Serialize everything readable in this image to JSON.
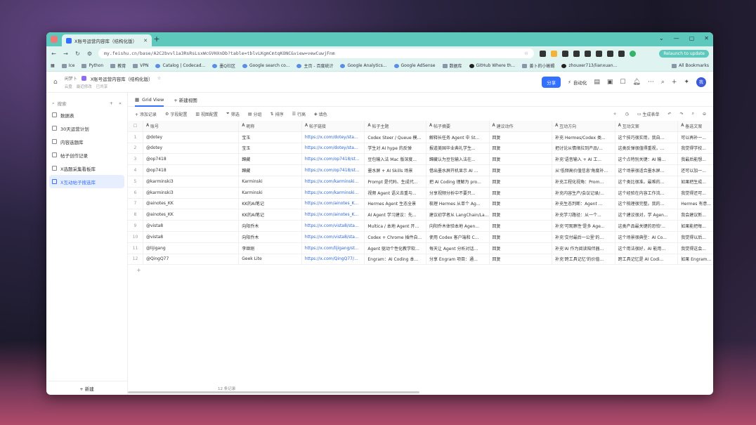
{
  "browser": {
    "tab_title": "X账号运营内容库（结构化版）",
    "url": "my.feishu.cn/base/A2C2bvvl1a3RsRsLsxWcGVHXnDb?table=tblvLKgmCmtqKONC&view=vewCuwjFnm",
    "update_label": "Relaunch to update",
    "bookmarks": [
      "Ice",
      "Python",
      "教育",
      "VPN",
      "Catalog | Codecad...",
      "墨Q社区",
      "Google search co...",
      "主页 - 百度统计",
      "Google Analytics...",
      "Google AdSense",
      "数据库",
      "GitHub Where th...",
      "姜卜的小蜥蜴",
      "zhouxer713/lianxuan..."
    ],
    "all_bookmarks": "All Bookmarks"
  },
  "app": {
    "crumb_root": "闲梦卜",
    "title": "X账号运营内容库（结构化版）",
    "crumb_sub": [
      "云盘",
      "最近修改",
      "已共享"
    ],
    "share": "分享",
    "automation": "自动化",
    "avatar": "我"
  },
  "sidebar": {
    "search": "搜索",
    "items": [
      "数据表",
      "30天运营计划",
      "内容选题库",
      "帖子创作记录",
      "X选题采集看板库",
      "X互动帖子搜选库"
    ],
    "new": "+ 新建"
  },
  "views": {
    "grid": "Grid View",
    "new_view": "+ 新建视图"
  },
  "toolbar": {
    "left": [
      "+ 添加记录",
      "字段配置",
      "视图配置",
      "筛选",
      "分组",
      "排序",
      "行高",
      "填色"
    ],
    "right": [
      "生成表单"
    ]
  },
  "table": {
    "headers": [
      "账号",
      "昵称",
      "帖子链接",
      "帖子主题",
      "帖子摘要",
      "建议动作",
      "互动方向",
      "互动文案",
      "备选文案"
    ],
    "rows": [
      [
        "1",
        "@dotey",
        "宝玉",
        "https://x.com/dotey/sta...",
        "Codex Steer / Queue 模...",
        "解释长任务 Agent 中 St...",
        "回复",
        "补充 Hermes/Codex 类...",
        "这个技巧很实用，我自...",
        "可以再补一..."
      ],
      [
        "2",
        "@dotey",
        "宝玉",
        "https://x.com/dotey/sta...",
        "学生对 AI hype 的反弹",
        "报道美国毕业典礼学生...",
        "回复",
        "把讨论从情绪拉到产品/...",
        "这类反弹很值得重视，...",
        "我觉得学校..."
      ],
      [
        "3",
        "@op7418",
        "歸藏",
        "https://x.com/op7418/st...",
        "豆包输入法 Mac 版深度...",
        "歸藏认为豆包输入法在...",
        "回复",
        "补充'语音输入 + AI 工...",
        "这个点特别关键：AI 输...",
        "我最后能想..."
      ],
      [
        "4",
        "@op7418",
        "歸藏",
        "https://x.com/op7418/st...",
        "墨水屏 + AI Skills 场景",
        "借出墨水屏开机显示 AI ...",
        "回复",
        "从'低频高价值信息'角度补...",
        "这个场景很适合墨水屏...",
        "还可以加一..."
      ],
      [
        "5",
        "@karminski3",
        "Karminski",
        "https://x.com/karminski...",
        "Prompt 是代码、生成代...",
        "把 AI Coding 理解为 pro...",
        "回复",
        "补充工程化视角：Prom...",
        "这个类比很准。最难的...",
        "如果把生成..."
      ],
      [
        "6",
        "@karminski3",
        "Karminski",
        "https://x.com/karminski...",
        "视频 Agent 语义去重与...",
        "分享视频分析中不要只...",
        "回复",
        "补充内容生产/会议记录/...",
        "这个经验在内容工作流...",
        "我觉得还可..."
      ],
      [
        "7",
        "@ainotes_KK",
        "KK的AI笔记",
        "https://x.com/ainotes_K...",
        "Hermes Agent 生态全景",
        "梳理 Hermes 从单个 Ag...",
        "回复",
        "补充生态判断：Agent ...",
        "这个梳理很完整。我的...",
        "Hermes 有意..."
      ],
      [
        "8",
        "@ainotes_KK",
        "KK的AI笔记",
        "https://x.com/ainotes_K...",
        "AI Agent 学习建议：先...",
        "建议初学者从 LangChain/La...",
        "回复",
        "补充学习路径：从一个...",
        "这个建议很对，学 Agen...",
        "我会建议新..."
      ],
      [
        "9",
        "@vista8",
        "向阳乔木",
        "https://x.com/vista8/sta...",
        "Multica / 本地 Agent 开...",
        "向阳乔木体验本地 Agen...",
        "回复",
        "补充'可观察性'是多 Age...",
        "这类产品最关键的恐怕'...",
        "如果能把每..."
      ],
      [
        "10",
        "@vista8",
        "向阳乔木",
        "https://x.com/vista8/sta...",
        "Codex + Chrome 插件自...",
        "使用 Codex 客户端和 C...",
        "回复",
        "补充'交付最后一公里'的...",
        "这个场景很典型：AI Co...",
        "我觉得以后..."
      ],
      [
        "11",
        "@lijigang",
        "李继刚",
        "https://x.com/lijigang/st...",
        "Agent 驱动个性化教学软...",
        "每天让 Agent 分析对话...",
        "回复",
        "补充'AI 作为阅读陪伴器...",
        "这个用法很好，AI 能用...",
        "我觉得这会..."
      ],
      [
        "12",
        "@QingQ77",
        "Geek Lite",
        "https://x.com/QingQ77/...",
        "Engram：AI Coding 本...",
        "分享 Engram 项目：通...",
        "回复",
        "补充'跨工具记忆'的价值...",
        "跨工具记忆是 AI Codi...",
        "如果 Engram..."
      ]
    ],
    "count_label": "12 条记录"
  }
}
